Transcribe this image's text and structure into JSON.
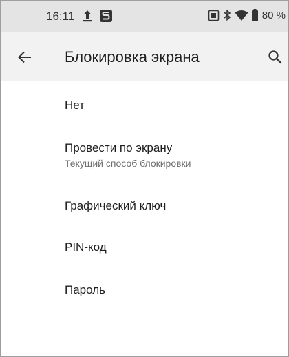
{
  "status_bar": {
    "time": "16:11",
    "icons_left": [
      "upload-icon",
      "s-app-icon"
    ],
    "icons_right": [
      "vibrate-icon",
      "bluetooth-icon",
      "wifi-icon",
      "battery-icon"
    ],
    "battery": "80 %"
  },
  "app_bar": {
    "title": "Блокировка экрана",
    "back_icon": "arrow-back-icon",
    "search_icon": "search-icon"
  },
  "options": [
    {
      "title": "Нет",
      "subtitle": ""
    },
    {
      "title": "Провести по экрану",
      "subtitle": "Текущий способ блокировки"
    },
    {
      "title": "Графический ключ",
      "subtitle": ""
    },
    {
      "title": "PIN-код",
      "subtitle": ""
    },
    {
      "title": "Пароль",
      "subtitle": ""
    }
  ],
  "colors": {
    "status_bar_bg": "#e4e4e4",
    "app_bar_bg": "#f2f2f2",
    "text_primary": "#202020",
    "text_secondary": "#6f6f6f"
  }
}
